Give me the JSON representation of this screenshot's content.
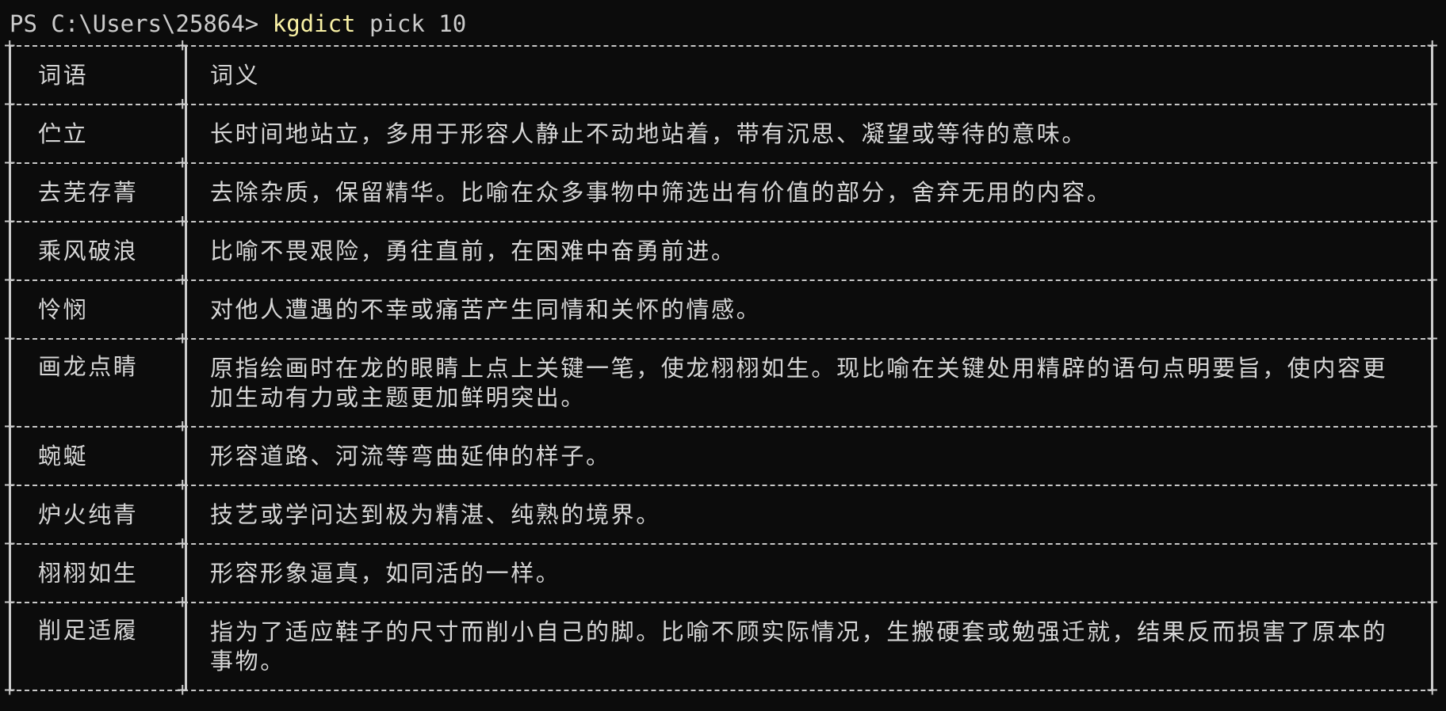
{
  "terminal": {
    "prompt": "PS C:\\Users\\25864> ",
    "command": "kgdict",
    "args": " pick 10"
  },
  "table": {
    "headers": {
      "word": "词语",
      "meaning": "词义"
    },
    "rows": [
      {
        "word": "伫立",
        "meaning": "长时间地站立，多用于形容人静止不动地站着，带有沉思、凝望或等待的意味。"
      },
      {
        "word": "去芜存菁",
        "meaning": "去除杂质，保留精华。比喻在众多事物中筛选出有价值的部分，舍弃无用的内容。"
      },
      {
        "word": "乘风破浪",
        "meaning": "比喻不畏艰险，勇往直前，在困难中奋勇前进。"
      },
      {
        "word": "怜悯",
        "meaning": "对他人遭遇的不幸或痛苦产生同情和关怀的情感。"
      },
      {
        "word": "画龙点睛",
        "meaning": "原指绘画时在龙的眼睛上点上关键一笔，使龙栩栩如生。现比喻在关键处用精辟的语句点明要旨，使内容更加生动有力或主题更加鲜明突出。"
      },
      {
        "word": "蜿蜒",
        "meaning": "形容道路、河流等弯曲延伸的样子。"
      },
      {
        "word": "炉火纯青",
        "meaning": "技艺或学问达到极为精湛、纯熟的境界。"
      },
      {
        "word": "栩栩如生",
        "meaning": "形容形象逼真，如同活的一样。"
      },
      {
        "word": "削足适履",
        "meaning": "指为了适应鞋子的尺寸而削小自己的脚。比喻不顾实际情况，生搬硬套或勉强迁就，结果反而损害了原本的事物。"
      }
    ]
  }
}
